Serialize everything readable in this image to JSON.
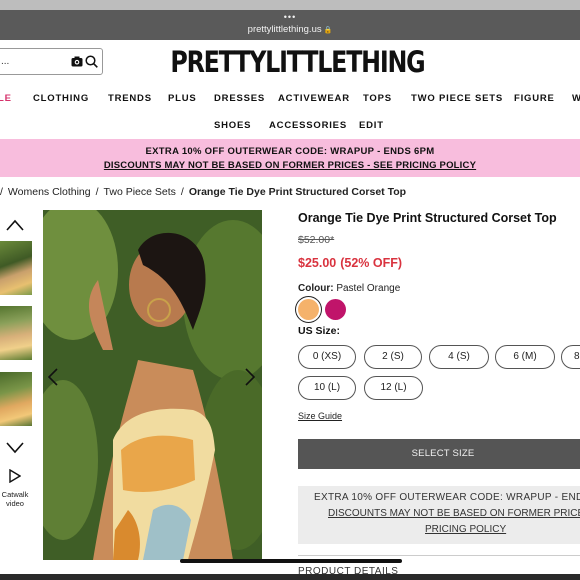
{
  "browser": {
    "dots": "•••",
    "url": "prettylittlething.us",
    "lock": "🔒"
  },
  "search": {
    "placeholder": "..."
  },
  "logo": "PRETTYLITTLETHING",
  "nav": {
    "row1": [
      "LE",
      "CLOTHING",
      "TRENDS",
      "PLUS",
      "DRESSES",
      "ACTIVEWEAR",
      "TOPS",
      "TWO PIECE SETS",
      "FIGURE",
      "W"
    ],
    "row2": [
      "SHOES",
      "ACCESSORIES",
      "EDIT"
    ]
  },
  "promo": {
    "line1": "EXTRA 10% OFF OUTERWEAR CODE: WRAPUP - ENDS 6PM",
    "line2": "DISCOUNTS MAY NOT BE BASED ON FORMER PRICES - SEE PRICING POLICY"
  },
  "breadcrumb": [
    "/",
    "Womens Clothing",
    "/",
    "Two Piece Sets",
    "/",
    "Orange Tie Dye Print Structured Corset Top"
  ],
  "gallery": {
    "catwalk_line1": "Catwalk",
    "catwalk_line2": "video"
  },
  "product": {
    "title": "Orange Tie Dye Print Structured Corset Top",
    "old_price": "$52.00*",
    "new_price": "$25.00",
    "discount": "(52% OFF)",
    "colour_label": "Colour:",
    "colour_value": "Pastel Orange",
    "swatches": [
      "#f5b26b",
      "#c0146a"
    ],
    "size_label": "US Size:",
    "sizes": [
      "0 (XS)",
      "2 (S)",
      "4 (S)",
      "6 (M)",
      "8",
      "10 (L)",
      "12 (L)"
    ],
    "size_guide": "Size Guide",
    "select_button": "SELECT SIZE",
    "promo_line1": "EXTRA 10% OFF OUTERWEAR CODE: WRAPUP - END",
    "promo_line2": "DISCOUNTS MAY NOT BE BASED ON FORMER PRICES -",
    "promo_line3": "PRICING POLICY",
    "details": "PRODUCT DETAILS"
  },
  "colors": {
    "sale": "#d6336c",
    "promo_bg": "#f8bddd",
    "price_red": "#d9333f",
    "button": "#555555"
  }
}
